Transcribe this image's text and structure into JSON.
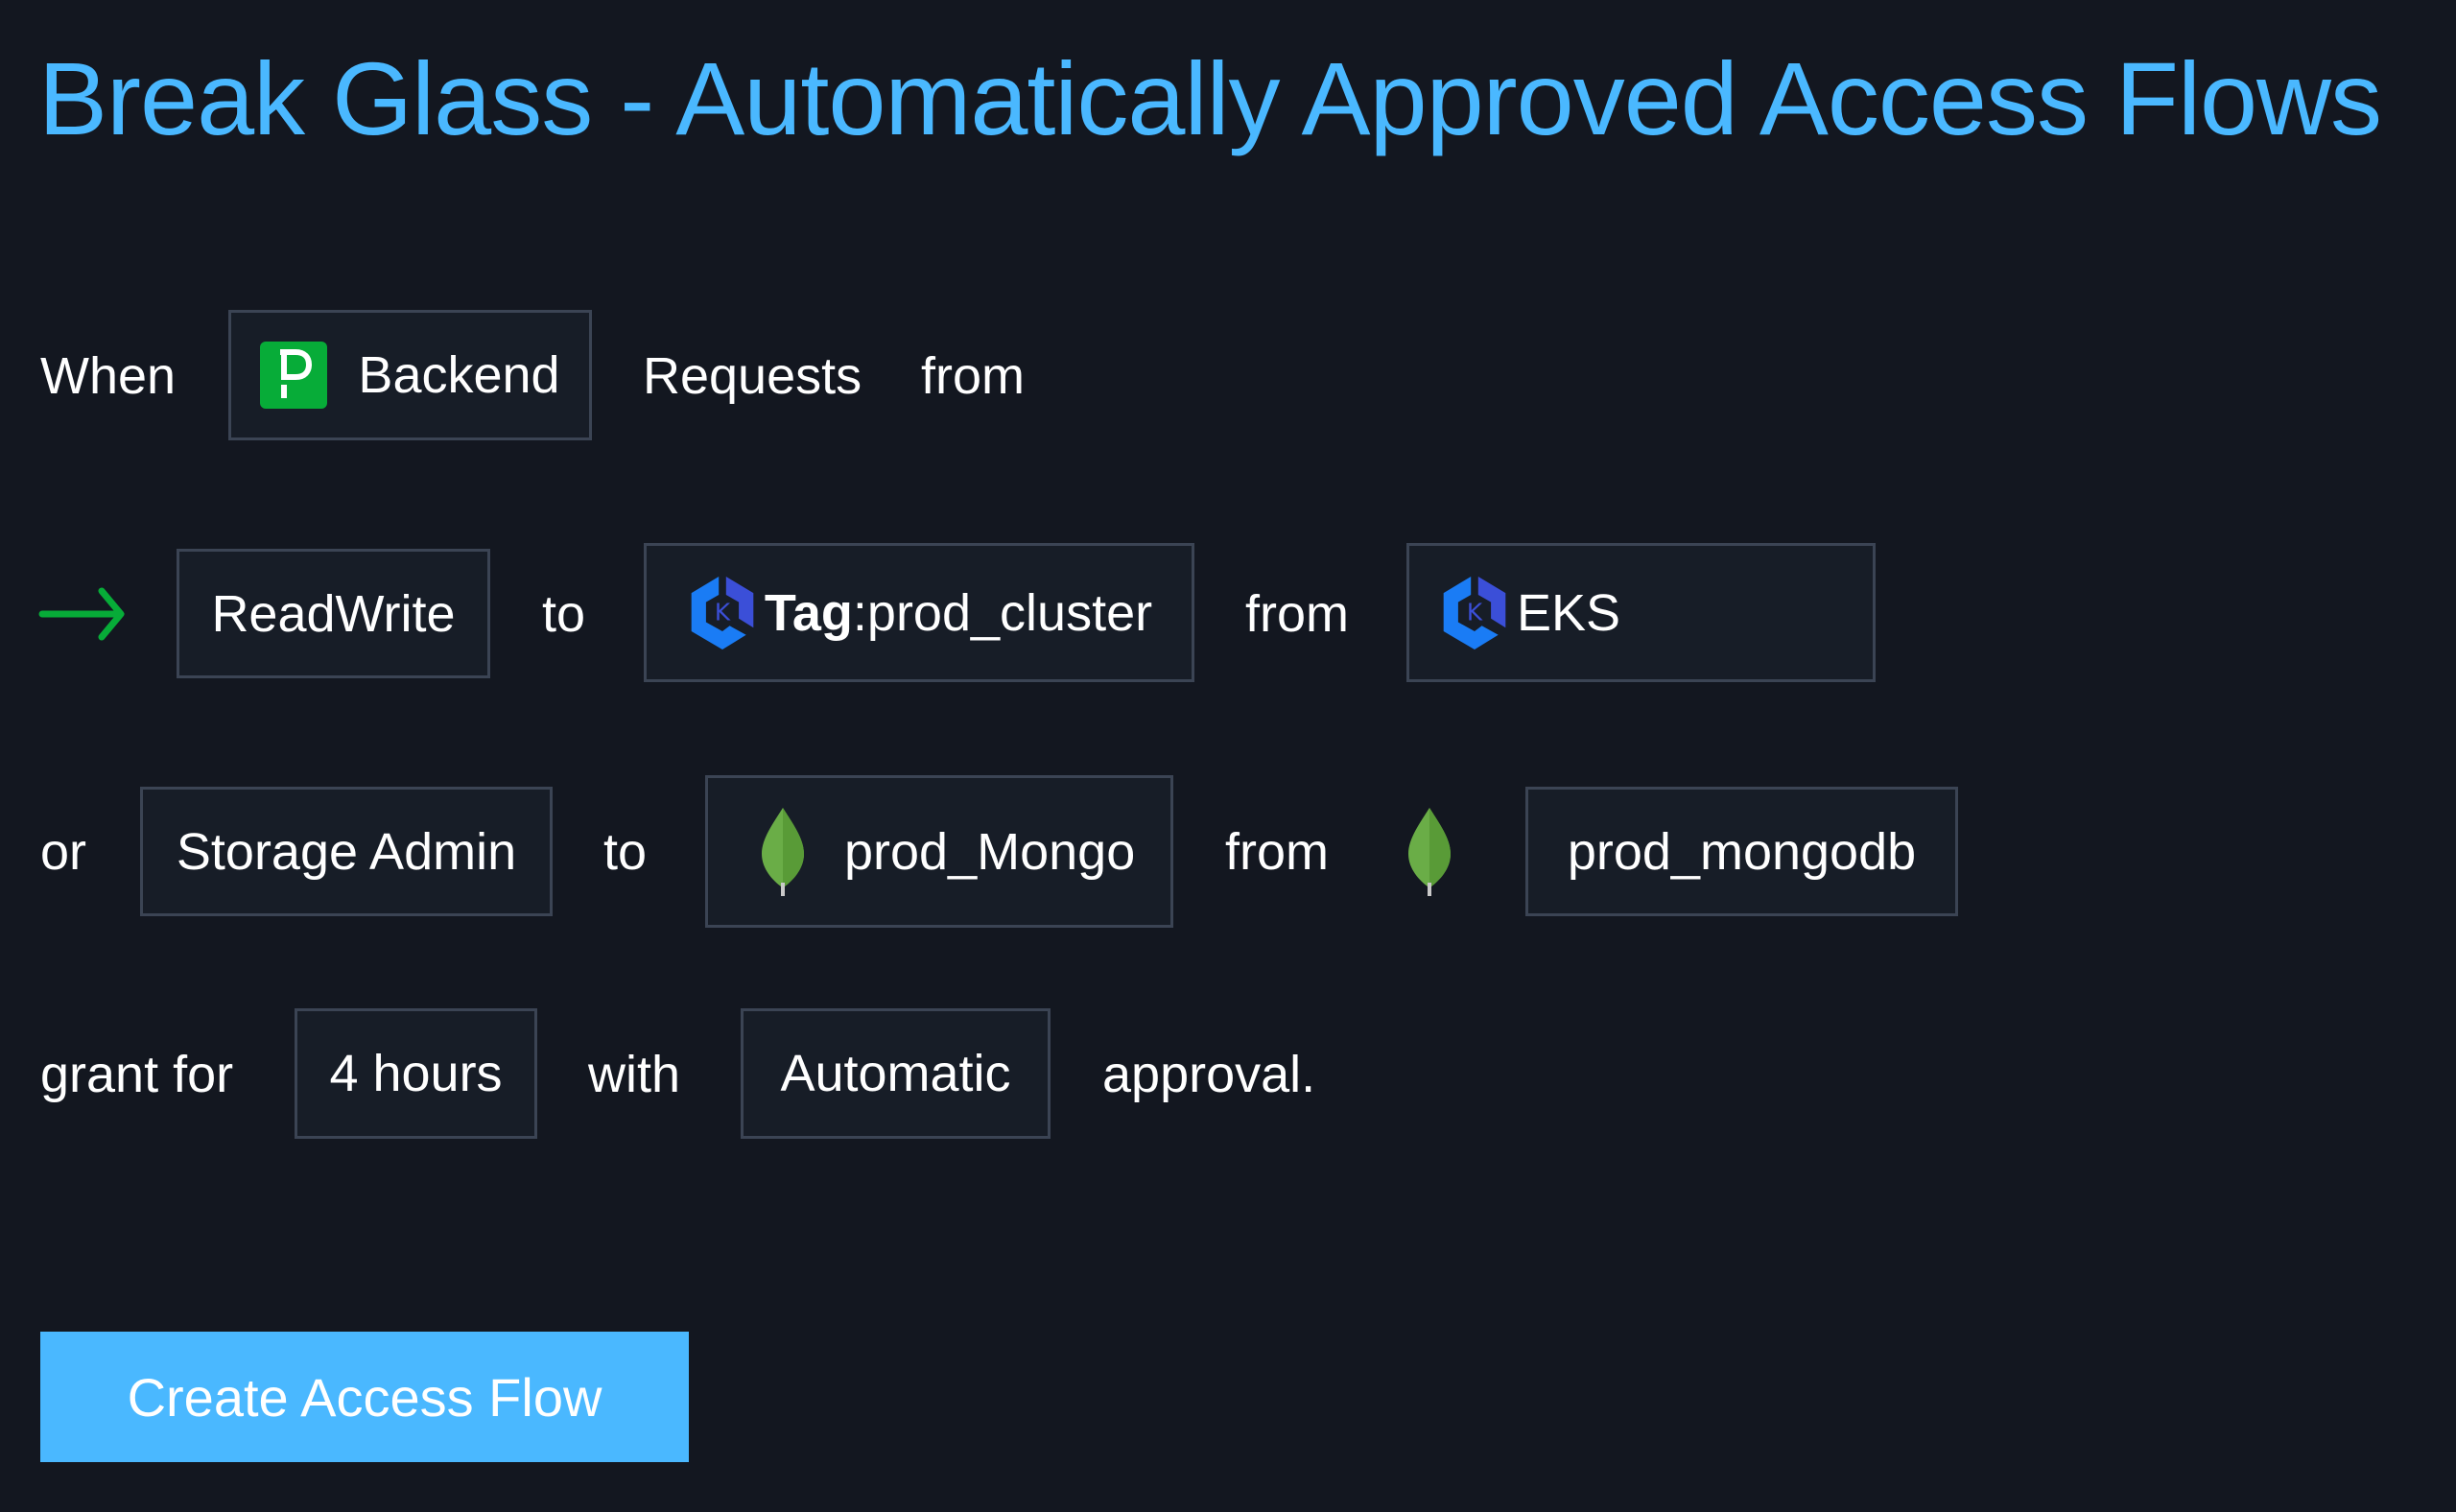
{
  "page": {
    "title": "Break Glass - Automatically Approved Access Flows"
  },
  "flow": {
    "row1": {
      "when_label": "When",
      "requester": {
        "label": "Backend",
        "icon": "pagerduty-icon"
      },
      "requests_label": "Requests",
      "from_label": "from"
    },
    "row2": {
      "arrow_icon": "arrow-right-icon",
      "permission": "ReadWrite",
      "to_label": "to",
      "resource": {
        "tag_label": "Tag",
        "separator": ":",
        "value": "prod_cluster",
        "icon": "kubernetes-eks-icon"
      },
      "from_label": "from",
      "integration": {
        "label": "EKS",
        "icon": "kubernetes-eks-icon"
      }
    },
    "row3": {
      "or_label": "or",
      "permission": "Storage Admin",
      "to_label": "to",
      "resource": {
        "label": "prod_Mongo",
        "icon": "mongodb-leaf-icon"
      },
      "from_label": "from",
      "integration_icon": "mongodb-leaf-icon",
      "integration": {
        "label": "prod_mongodb"
      }
    },
    "row4": {
      "grant_for_label": "grant for",
      "duration": "4 hours",
      "with_label": "with",
      "approval_type": "Automatic",
      "approval_label": "approval."
    }
  },
  "actions": {
    "create_label": "Create Access Flow"
  },
  "colors": {
    "background": "#131720",
    "accent": "#4ab8ff",
    "box_background": "#171d27",
    "box_border": "#3b4454",
    "pagerduty_green": "#07ac38",
    "arrow_green": "#07ac38",
    "kubernetes_blue": "#1a7cf5",
    "kubernetes_indigo": "#3b4fd8",
    "mongo_green": "#6aad47"
  }
}
